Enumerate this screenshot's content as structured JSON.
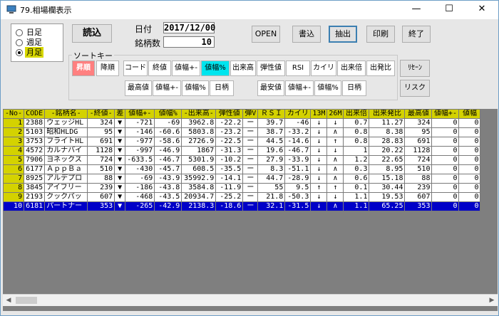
{
  "window": {
    "title": "79.相場欄表示",
    "minimize": "—",
    "maximize": "☐",
    "close": "✕"
  },
  "period": {
    "options": [
      "日足",
      "週足",
      "月足"
    ],
    "selected": "月足"
  },
  "load_button": "読込",
  "date": {
    "label": "日付",
    "value": "2017/12/00"
  },
  "count": {
    "label": "銘柄数",
    "value": "10"
  },
  "top_buttons": {
    "open": "OPEN",
    "write": "書込",
    "extract": "抽出",
    "print": "印刷",
    "exit": "終了"
  },
  "sort": {
    "legend": "ソートキー",
    "asc": "昇順",
    "desc": "降順",
    "row1": [
      "コード",
      "終値",
      "値幅+-",
      "値幅%",
      "出来高",
      "弾性値",
      "RSI",
      "カイリ",
      "出来倍",
      "出発比"
    ],
    "row2_high": [
      "最高値",
      "値幅+-",
      "値幅%",
      "日柄"
    ],
    "row2_low": [
      "最安値",
      "値幅+-",
      "値幅%",
      "日柄"
    ],
    "reset": "ﾘｾｰﾝ",
    "risk": "リスク"
  },
  "table": {
    "headers": [
      "-No-",
      "CODE",
      "-銘柄名-",
      "-終値-",
      "差",
      "値幅+-",
      "値幅%",
      "-出来高-",
      "弾性値",
      "弾V",
      "ＲＳＩ",
      "カイリ",
      "13M",
      "26M",
      "出来倍",
      "出来発比",
      "最高値",
      "値幅+-",
      "値幅"
    ],
    "rows": [
      [
        "1",
        "2388",
        "ウェッジHL",
        "324",
        "▼",
        "-721",
        "-69",
        "3962.8",
        "-22.2",
        "ー",
        "39.7",
        "-46",
        "↓",
        "↓",
        "0.7",
        "11.27",
        "324",
        "0",
        "0"
      ],
      [
        "2",
        "5103",
        "昭和HLDG",
        "95",
        "▼",
        "-146",
        "-60.6",
        "5803.8",
        "-23.2",
        "ー",
        "38.7",
        "-33.2",
        "↓",
        "∧",
        "0.8",
        "8.38",
        "95",
        "0",
        "0"
      ],
      [
        "3",
        "3753",
        "フライトHL",
        "691",
        "▼",
        "-977",
        "-58.6",
        "2726.9",
        "-22.5",
        "ー",
        "44.5",
        "-14.6",
        "↓",
        "↑",
        "0.8",
        "28.83",
        "691",
        "0",
        "0"
      ],
      [
        "4",
        "4572",
        "カルナバイ",
        "1128",
        "▼",
        "-997",
        "-46.9",
        "1867",
        "-31.3",
        "ー",
        "19.6",
        "-46.7",
        "↓",
        "↓",
        "1",
        "20.22",
        "1128",
        "0",
        "0"
      ],
      [
        "5",
        "7906",
        "ヨネックス",
        "724",
        "▼",
        "-633.5",
        "-46.7",
        "5301.9",
        "-10.2",
        "ー",
        "27.9",
        "-33.9",
        "↓",
        "∧",
        "1.2",
        "22.65",
        "724",
        "0",
        "0"
      ],
      [
        "6",
        "6177",
        "ＡｐｐＢａ",
        "510",
        "▼",
        "-430",
        "-45.7",
        "608.5",
        "-35.5",
        "ー",
        "8.3",
        "-51.1",
        "↓",
        "∧",
        "0.3",
        "8.95",
        "510",
        "0",
        "0"
      ],
      [
        "7",
        "8925",
        "アルデプロ",
        "88",
        "▼",
        "-69",
        "-43.9",
        "35992.9",
        "-14.1",
        "ー",
        "44.7",
        "-28.9",
        "↓",
        "∧",
        "0.6",
        "15.18",
        "88",
        "0",
        "0"
      ],
      [
        "8",
        "3845",
        "アイフリー",
        "239",
        "▼",
        "-186",
        "-43.8",
        "3584.8",
        "-11.9",
        "ー",
        "55",
        "9.5",
        "↑",
        "↑",
        "0.1",
        "30.44",
        "239",
        "0",
        "0"
      ],
      [
        "9",
        "2193",
        "クックパッ",
        "607",
        "▼",
        "-468",
        "-43.5",
        "20934.7",
        "-25.2",
        "ー",
        "21.8",
        "-50.3",
        "↓",
        "↓",
        "1.1",
        "19.53",
        "607",
        "0",
        "0"
      ],
      [
        "10",
        "6181",
        "パートナー",
        "353",
        "▼",
        "-265",
        "-42.9",
        "2138.3",
        "-18.6",
        "ー",
        "32.1",
        "-31.5",
        "↓",
        "∧",
        "1.1",
        "65.25",
        "353",
        "0",
        "0"
      ]
    ],
    "selected_row": 9
  },
  "colors": {
    "header_bg": "#d4d200",
    "selected_row": "#0000c8",
    "asc_button": "#ff8080",
    "active_sort": "#00e5ee"
  }
}
